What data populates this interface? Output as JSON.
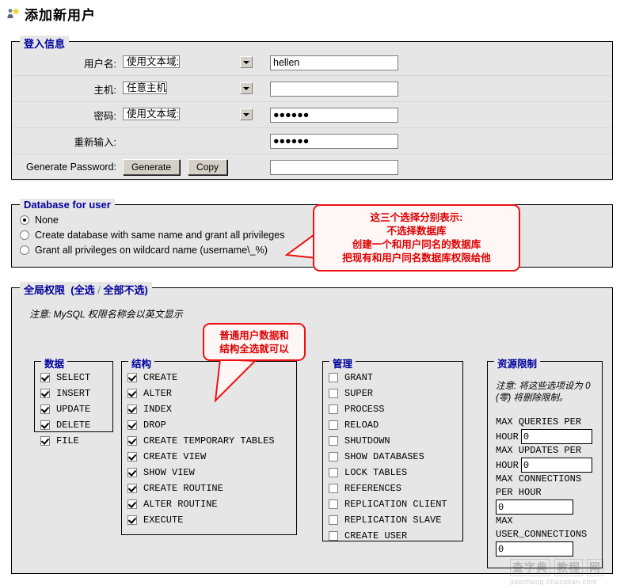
{
  "page": {
    "title": "添加新用户",
    "title_icon": "add-user-icon"
  },
  "login_info": {
    "legend": "登入信息",
    "rows": [
      {
        "label": "用户名:",
        "select_value": "使用文本域:",
        "input_value": "hellen",
        "has_select": true,
        "has_input": true
      },
      {
        "label": "主机:",
        "select_value": "任意主机",
        "input_value": "",
        "has_select": true,
        "has_input": true
      },
      {
        "label": "密码:",
        "select_value": "使用文本域:",
        "input_value": "●●●●●●",
        "has_select": true,
        "has_input": true
      },
      {
        "label": "重新输入:",
        "select_value": "",
        "input_value": "●●●●●●",
        "has_select": false,
        "has_input": true
      }
    ],
    "generate_label": "Generate Password:",
    "generate_button": "Generate",
    "copy_button": "Copy",
    "generated_value": ""
  },
  "database_for_user": {
    "legend": "Database for user",
    "options": [
      {
        "label": "None",
        "checked": true
      },
      {
        "label": "Create database with same name and grant all privileges",
        "checked": false
      },
      {
        "label": "Grant all privileges on wildcard name (username\\_%)",
        "checked": false
      }
    ]
  },
  "global_privileges": {
    "legend_main": "全局权限",
    "legend_check_all": "(全选",
    "legend_sep": "/",
    "legend_uncheck_all": "全部不选)",
    "note": "注意: MySQL 权限名称会以英文显示",
    "groups": [
      {
        "legend": "数据",
        "items": [
          {
            "label": "SELECT",
            "checked": true
          },
          {
            "label": "INSERT",
            "checked": true
          },
          {
            "label": "UPDATE",
            "checked": true
          },
          {
            "label": "DELETE",
            "checked": true
          },
          {
            "label": "FILE",
            "checked": true
          }
        ]
      },
      {
        "legend": "结构",
        "items": [
          {
            "label": "CREATE",
            "checked": true
          },
          {
            "label": "ALTER",
            "checked": true
          },
          {
            "label": "INDEX",
            "checked": true
          },
          {
            "label": "DROP",
            "checked": true
          },
          {
            "label": "CREATE TEMPORARY TABLES",
            "checked": true
          },
          {
            "label": "CREATE VIEW",
            "checked": true
          },
          {
            "label": "SHOW VIEW",
            "checked": true
          },
          {
            "label": "CREATE ROUTINE",
            "checked": true
          },
          {
            "label": "ALTER ROUTINE",
            "checked": true
          },
          {
            "label": "EXECUTE",
            "checked": true
          }
        ]
      },
      {
        "legend": "管理",
        "items": [
          {
            "label": "GRANT",
            "checked": false
          },
          {
            "label": "SUPER",
            "checked": false
          },
          {
            "label": "PROCESS",
            "checked": false
          },
          {
            "label": "RELOAD",
            "checked": false
          },
          {
            "label": "SHUTDOWN",
            "checked": false
          },
          {
            "label": "SHOW DATABASES",
            "checked": false
          },
          {
            "label": "LOCK TABLES",
            "checked": false
          },
          {
            "label": "REFERENCES",
            "checked": false
          },
          {
            "label": "REPLICATION CLIENT",
            "checked": false
          },
          {
            "label": "REPLICATION SLAVE",
            "checked": false
          },
          {
            "label": "CREATE USER",
            "checked": false
          }
        ]
      }
    ],
    "resource_limits": {
      "legend": "资源限制",
      "note": "注意: 将这些选项设为 0 (零) 将删除限制。",
      "fields": [
        {
          "label_a": "MAX QUERIES PER",
          "label_b": "HOUR",
          "inline": true,
          "value": "0"
        },
        {
          "label_a": "MAX UPDATES PER",
          "label_b": "HOUR",
          "inline": true,
          "value": "0"
        },
        {
          "label_a": "MAX CONNECTIONS",
          "label_b": "PER HOUR",
          "inline": false,
          "value": "0"
        },
        {
          "label_a": "MAX",
          "label_b": "USER_CONNECTIONS",
          "inline": false,
          "value": "0"
        }
      ]
    }
  },
  "annotations": {
    "database_callout": [
      "这三个选择分别表示:",
      "不选择数据库",
      "创建一个和用户同名的数据库",
      "把现有和用户同名数据库权限给他"
    ],
    "privileges_callout": [
      "普通用户数据和",
      "结构全选就可以"
    ],
    "accent_color": "#ee1111"
  },
  "watermark": {
    "brand_a": "查字典",
    "brand_b": "教程",
    "brand_c": "网",
    "url": "jiaocheng.chazidian.com"
  }
}
